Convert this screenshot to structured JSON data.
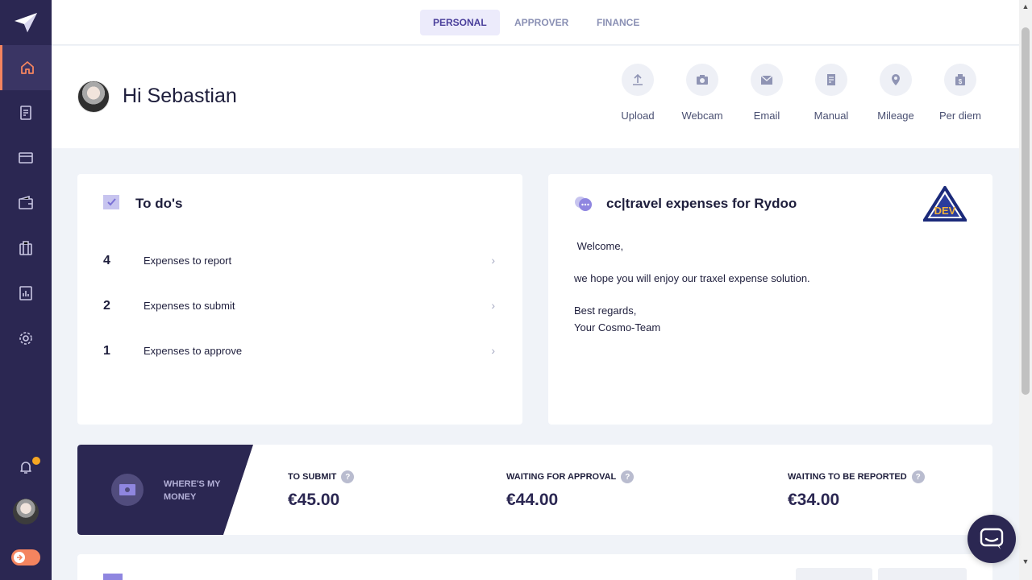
{
  "colors": {
    "sidebar": "#2b2752",
    "accent": "#f4845f",
    "tab_active_bg": "#ecebfb",
    "tab_active_text": "#4a3f9b",
    "badge": "#f5a623"
  },
  "sidebar": {
    "items": [
      {
        "icon": "home-icon",
        "active": true
      },
      {
        "icon": "receipt-icon"
      },
      {
        "icon": "card-icon"
      },
      {
        "icon": "wallet-icon"
      },
      {
        "icon": "luggage-icon"
      },
      {
        "icon": "report-chart-icon"
      },
      {
        "icon": "gear-icon"
      }
    ],
    "bottom": [
      {
        "icon": "bell-icon",
        "badge": "star"
      },
      {
        "icon": "avatar"
      },
      {
        "icon": "toggle-arrow-icon"
      }
    ]
  },
  "tabs": [
    {
      "label": "PERSONAL",
      "active": true
    },
    {
      "label": "APPROVER"
    },
    {
      "label": "FINANCE"
    }
  ],
  "header": {
    "greeting": "Hi Sebastian"
  },
  "actions": [
    {
      "label": "Upload",
      "icon": "upload-icon"
    },
    {
      "label": "Webcam",
      "icon": "camera-icon"
    },
    {
      "label": "Email",
      "icon": "mail-icon"
    },
    {
      "label": "Manual",
      "icon": "document-icon"
    },
    {
      "label": "Mileage",
      "icon": "location-pin-icon"
    },
    {
      "label": "Per diem",
      "icon": "money-bag-icon"
    }
  ],
  "todo": {
    "title": "To do's",
    "items": [
      {
        "count": "4",
        "label": "Expenses to report"
      },
      {
        "count": "2",
        "label": "Expenses to submit"
      },
      {
        "count": "1",
        "label": "Expenses to approve"
      }
    ]
  },
  "message": {
    "title": "cc|travel expenses for Rydoo",
    "logo_text": "DEV",
    "lines": [
      " Welcome,",
      "we hope you will enjoy our traxel expense solution.",
      "Best regards,",
      "Your Cosmo-Team"
    ]
  },
  "money": {
    "label": "WHERE'S MY MONEY",
    "stats": [
      {
        "label": "TO SUBMIT",
        "value": "€45.00"
      },
      {
        "label": "WAITING FOR APPROVAL",
        "value": "€44.00"
      },
      {
        "label": "WAITING TO BE REPORTED",
        "value": "€34.00"
      }
    ]
  },
  "help_symbol": "?",
  "chevron": "›"
}
